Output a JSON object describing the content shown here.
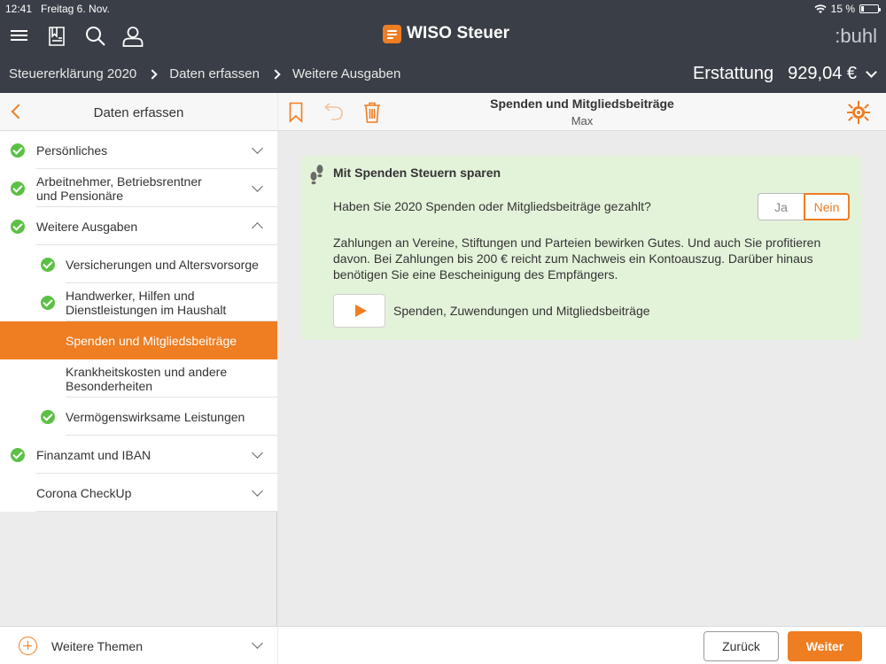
{
  "status_bar": {
    "time": "12:41",
    "date": "Freitag 6. Nov.",
    "battery": "15 %"
  },
  "header": {
    "app_name": "WISO Steuer",
    "vendor": ":buhl",
    "breadcrumbs": [
      "Steuererklärung 2020",
      "Daten erfassen",
      "Weitere Ausgaben"
    ],
    "refund_label": "Erstattung",
    "refund_amount": "929,04 €",
    "icons": [
      "menu-icon",
      "bookmark-list-icon",
      "search-icon",
      "user-icon"
    ]
  },
  "sidebar": {
    "title": "Daten erfassen",
    "items": [
      {
        "label": "Persönliches",
        "checked": true,
        "level": 0,
        "expand": "down"
      },
      {
        "label": "Arbeitnehmer, Betriebsrentner\nund Pensionäre",
        "checked": true,
        "level": 0,
        "expand": "down"
      },
      {
        "label": "Weitere Ausgaben",
        "checked": true,
        "level": 0,
        "expand": "up"
      },
      {
        "label": "Versicherungen und Altersvorsorge",
        "checked": true,
        "level": 1
      },
      {
        "label": "Handwerker, Hilfen und\nDienstleistungen im Haushalt",
        "checked": true,
        "level": 1
      },
      {
        "label": "Spenden und Mitgliedsbeiträge",
        "checked": false,
        "level": 1,
        "active": true
      },
      {
        "label": "Krankheitskosten und andere\nBesonderheiten",
        "checked": false,
        "level": 1
      },
      {
        "label": "Vermögenswirksame Leistungen",
        "checked": true,
        "level": 1
      },
      {
        "label": "Finanzamt und IBAN",
        "checked": true,
        "level": 0,
        "expand": "down"
      },
      {
        "label": "Corona CheckUp",
        "checked": false,
        "level": 0,
        "expand": "down"
      }
    ],
    "footer_label": "Weitere Themen"
  },
  "main": {
    "title": "Spenden und Mitgliedsbeiträge",
    "subtitle": "Max",
    "card": {
      "title": "Mit Spenden Steuern sparen",
      "question": "Haben Sie 2020 Spenden oder Mitgliedsbeiträge gezahlt?",
      "yes_label": "Ja",
      "no_label": "Nein",
      "selected": "Nein",
      "info": "Zahlungen an Vereine, Stiftungen und Parteien bewirken Gutes. Und auch Sie profitieren davon. Bei Zahlungen bis 200 € reicht zum Nachweis ein Kontoauszug. Darüber hinaus benötigen Sie eine Bescheinigung des Empfängers.",
      "video_label": "Spenden, Zuwendungen und Mitgliedsbeiträge"
    },
    "back_label": "Zurück",
    "next_label": "Weiter"
  },
  "colors": {
    "accent": "#ef7d22",
    "header_bg": "#3a3f47",
    "check": "#5cc046",
    "card_bg": "#e3f3da"
  }
}
